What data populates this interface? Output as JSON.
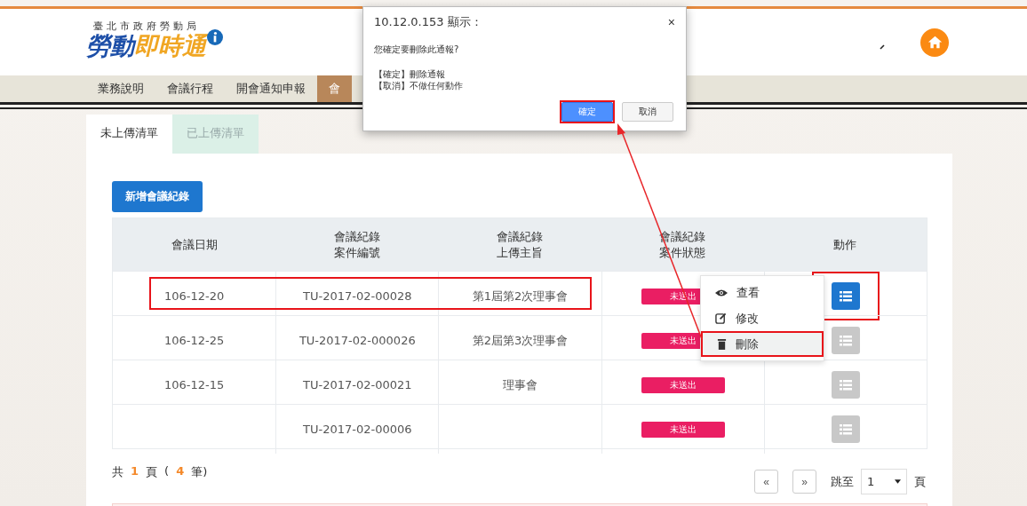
{
  "header": {
    "org": "臺北市政府勞動局",
    "brand_part_1": "勞動",
    "brand_part_2": "即時通"
  },
  "nav": [
    {
      "label": "業務說明",
      "selected": false
    },
    {
      "label": "會議行程",
      "selected": false
    },
    {
      "label": "開會通知申報",
      "selected": false
    },
    {
      "label": "會",
      "selected": true
    }
  ],
  "tabs": [
    {
      "label": "未上傳清單",
      "selected": true
    },
    {
      "label": "已上傳清單",
      "selected": false
    }
  ],
  "add_button": "新增會議紀錄",
  "table": {
    "columns": [
      [
        "會議日期"
      ],
      [
        "會議紀錄",
        "案件編號"
      ],
      [
        "會議紀錄",
        "上傳主旨"
      ],
      [
        "會議紀錄",
        "案件狀態"
      ],
      [
        "動作"
      ]
    ],
    "rows": [
      {
        "date": "106-12-20",
        "case_no": "TU-2017-02-00028",
        "subject": "第1屆第2次理事會",
        "status": "未送出",
        "action_active": true,
        "highlighted": true
      },
      {
        "date": "106-12-25",
        "case_no": "TU-2017-02-000026",
        "subject": "第2屆第3次理事會",
        "status": "未送出",
        "action_active": false,
        "highlighted": false
      },
      {
        "date": "106-12-15",
        "case_no": "TU-2017-02-00021",
        "subject": "理事會",
        "status": "未送出",
        "action_active": false,
        "highlighted": false
      },
      {
        "case_no": "TU-2017-02-00006",
        "status": "未送出",
        "action_active": false,
        "highlighted": false
      }
    ]
  },
  "menu": [
    {
      "kind": "view",
      "label": "查看",
      "selected": false
    },
    {
      "kind": "edit",
      "label": "修改",
      "selected": false
    },
    {
      "kind": "delete",
      "label": "刪除",
      "selected": true
    }
  ],
  "pager": {
    "total_prefix": "共",
    "pages": "1",
    "pages_unit": "頁",
    "open": "(",
    "count": "4",
    "count_unit": "筆)",
    "prev": "«",
    "next": "»",
    "jump_label": "跳至",
    "page_value": "1",
    "page_unit": "頁"
  },
  "dialog": {
    "title": "10.12.0.153 顯示：",
    "close": "×",
    "question": "您確定要刪除此通報?",
    "lines": [
      "【確定】刪除通報",
      "【取消】不做任何動作"
    ],
    "buttons": [
      {
        "label": "確定",
        "primary": true,
        "highlighted": true
      },
      {
        "label": "取消",
        "primary": false,
        "highlighted": false
      }
    ]
  }
}
